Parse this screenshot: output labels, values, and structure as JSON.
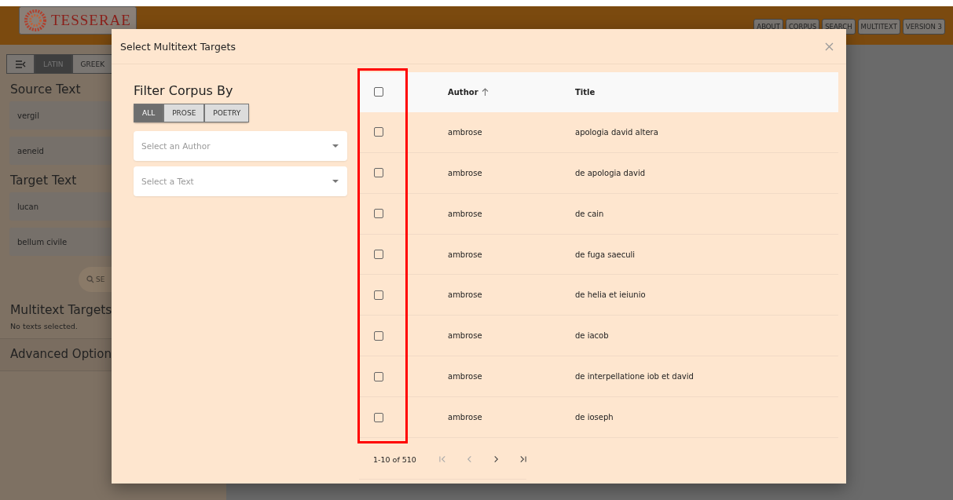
{
  "header": {
    "logo_text": "TESSERAE",
    "nav": [
      "ABOUT",
      "CORPUS",
      "SEARCH",
      "MULTITEXT",
      "VERSION 3"
    ]
  },
  "sidebar": {
    "language_tabs": [
      {
        "label": "LATIN",
        "selected": true
      },
      {
        "label": "GREEK",
        "selected": false
      }
    ],
    "source_heading": "Source Text",
    "source_fields": [
      "vergil",
      "aeneid"
    ],
    "target_heading": "Target Text",
    "target_fields": [
      "lucan",
      "bellum civile"
    ],
    "search_button": "SE",
    "multitext_heading": "Multitext Targets",
    "multitext_note": "No texts selected.",
    "advanced_heading": "Advanced Option"
  },
  "modal": {
    "title": "Select Multitext Targets",
    "filter_heading": "Filter Corpus By",
    "filters": [
      {
        "label": "ALL",
        "selected": true
      },
      {
        "label": "PROSE",
        "selected": false
      },
      {
        "label": "POETRY",
        "selected": false
      }
    ],
    "selects": [
      {
        "placeholder": "Select an Author"
      },
      {
        "placeholder": "Select a Text"
      }
    ],
    "table": {
      "columns": [
        {
          "label": "Author",
          "sorted": true
        },
        {
          "label": "Title",
          "sorted": false
        }
      ],
      "all_checked": false,
      "rows": [
        {
          "author": "ambrose",
          "title": "apologia david altera",
          "checked": false
        },
        {
          "author": "ambrose",
          "title": "de apologia david",
          "checked": false
        },
        {
          "author": "ambrose",
          "title": "de cain",
          "checked": false
        },
        {
          "author": "ambrose",
          "title": "de fuga saeculi",
          "checked": false
        },
        {
          "author": "ambrose",
          "title": "de helia et ieiunio",
          "checked": false
        },
        {
          "author": "ambrose",
          "title": "de iacob",
          "checked": false
        },
        {
          "author": "ambrose",
          "title": "de interpellatione iob et david",
          "checked": false
        },
        {
          "author": "ambrose",
          "title": "de ioseph",
          "checked": false
        }
      ]
    },
    "pagination": {
      "range": "1-10 of 510",
      "first_disabled": true,
      "prev_disabled": true
    }
  }
}
